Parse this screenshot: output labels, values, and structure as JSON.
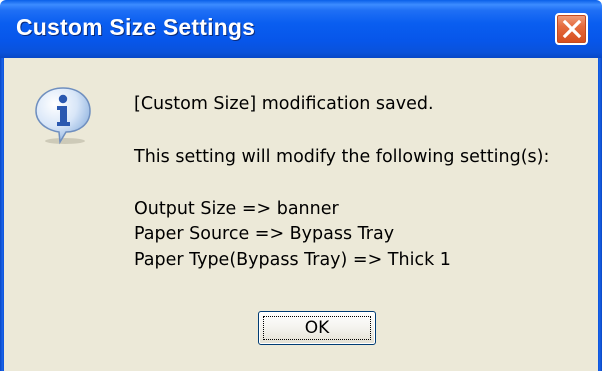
{
  "window": {
    "title": "Custom Size Settings",
    "close_icon": "close-icon"
  },
  "dialog": {
    "icon": "info-icon",
    "line1": "[Custom Size] modification saved.",
    "line2": "This setting will modify the following setting(s):",
    "changes": [
      "Output Size => banner",
      "Paper Source => Bypass Tray",
      "Paper Type(Bypass Tray) => Thick 1"
    ],
    "ok_label": "OK"
  },
  "colors": {
    "titlebar": "#0a5ef0",
    "client_bg": "#ece9d8",
    "close_button": "#e56c3f"
  }
}
